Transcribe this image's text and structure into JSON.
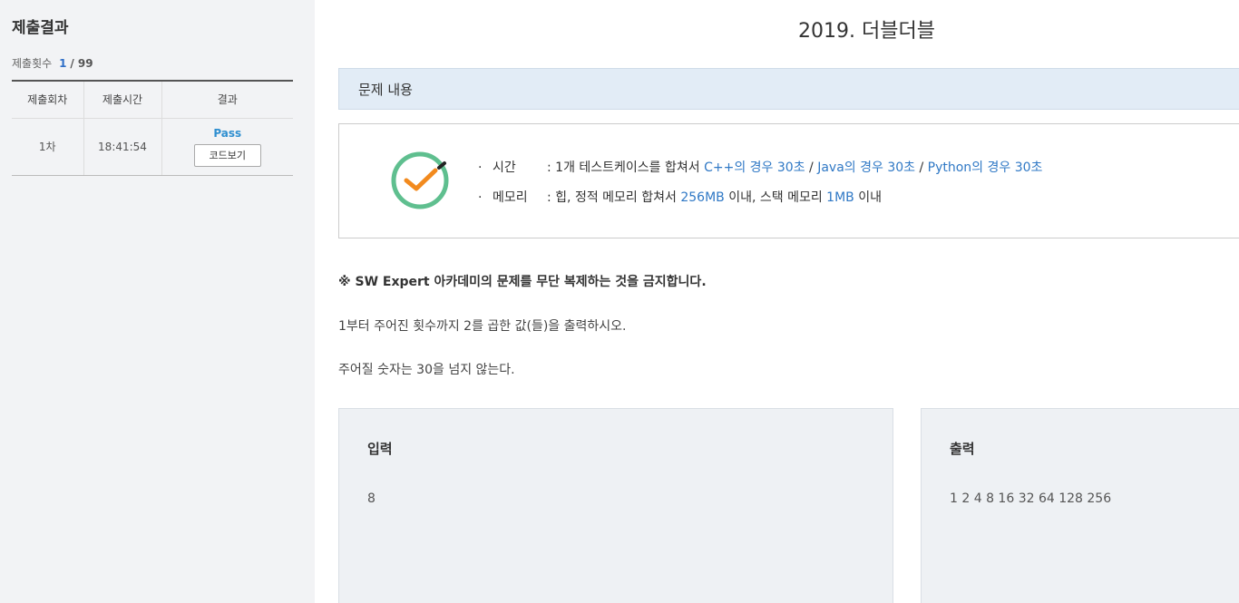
{
  "sidebar": {
    "title": "제출결과",
    "count_label": "제출횟수",
    "count_value": "1",
    "count_total": "/ 99",
    "table": {
      "headers": [
        "제출회차",
        "제출시간",
        "결과"
      ],
      "rows": [
        {
          "round": "1차",
          "time": "18:41:54",
          "result": "Pass",
          "button": "코드보기"
        }
      ]
    }
  },
  "main": {
    "title": "2019. 더블더블",
    "section_header": "문제 내용",
    "limits": {
      "time_label": "시간",
      "time_prefix": ": 1개 테스트케이스를 합쳐서 ",
      "time_cpp": "C++의 경우 30초",
      "time_sep1": " / ",
      "time_java": "Java의 경우 30초",
      "time_sep2": " / ",
      "time_python": "Python의 경우 30초",
      "memory_label": "메모리",
      "memory_prefix": ": 힙, 정적 메모리 합쳐서 ",
      "memory_heap": "256MB",
      "memory_mid": " 이내, 스택 메모리 ",
      "memory_stack": "1MB",
      "memory_suffix": " 이내"
    },
    "notice": "※ SW Expert 아카데미의 문제를 무단 복제하는 것을 금지합니다.",
    "description_1": "1부터 주어진 횟수까지 2를 곱한 값(들)을 출력하시오.",
    "description_2": "주어질 숫자는 30을 넘지 않는다.",
    "input": {
      "title": "입력",
      "value": "8"
    },
    "output": {
      "title": "출력",
      "value": "1 2 4 8 16 32 64 128 256"
    }
  },
  "colors": {
    "accent_blue": "#2f78c5",
    "check_green": "#5fbf8f",
    "check_orange": "#f28a1e"
  },
  "icons": {
    "check": "check-circle-icon",
    "bullet": "bullet-dot"
  }
}
